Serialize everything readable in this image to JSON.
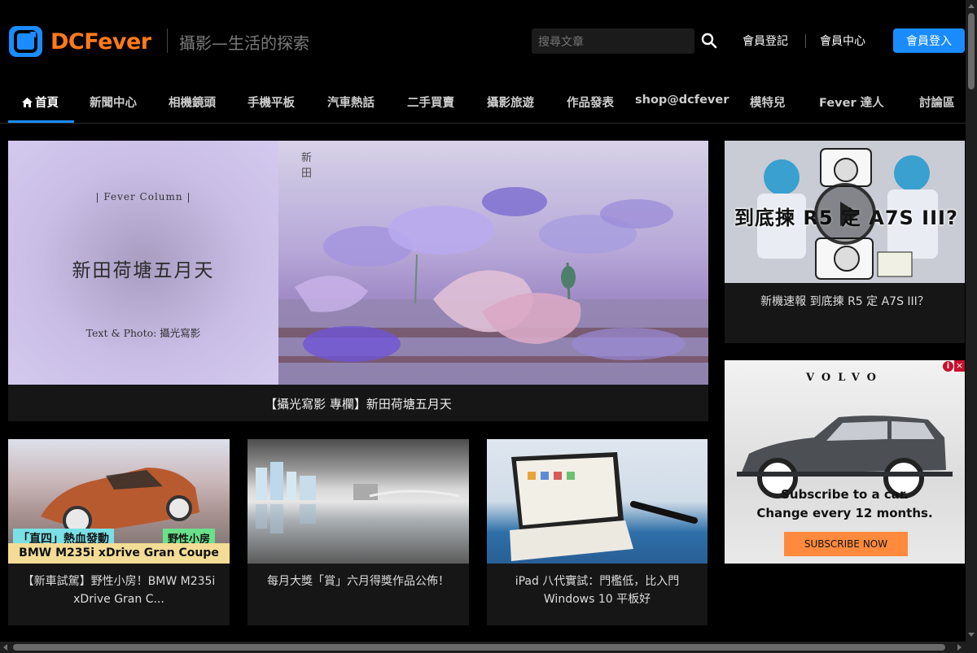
{
  "header": {
    "logo_text": "DCFever",
    "tagline": "攝影—生活的探索",
    "search_placeholder": "搜尋文章",
    "register": "會員登記",
    "member_center": "會員中心",
    "login": "會員登入"
  },
  "nav": {
    "items": [
      "首頁",
      "新聞中心",
      "相機鏡頭",
      "手機平板",
      "汽車熱話",
      "二手買賣",
      "攝影旅遊",
      "作品發表",
      "shop@dcfever",
      "模特兒",
      "Fever 達人",
      "討論區"
    ]
  },
  "hero": {
    "column_label": "| Fever Column |",
    "article_title": "新田荷塘五月天",
    "credit": "Text & Photo: 攝光寫影",
    "caption": "【攝光寫影 專欄】新田荷塘五月天"
  },
  "side_video": {
    "overlay": "到底揀 R5 定 A7S III?",
    "caption": "新機速報 到底揀 R5 定 A7S III？"
  },
  "ad": {
    "brand": "VOLVO",
    "line1": "Subscribe to a car.",
    "line2": "Change every 12 months.",
    "button": "SUBSCRIBE NOW"
  },
  "cards": [
    {
      "caption": "【新車試駕】野性小房！BMW M235i xDrive Gran C...",
      "badge1": "「直四」熱血發動",
      "badge2": "野性小房",
      "strip": "BMW M235i xDrive Gran Coupe"
    },
    {
      "caption": "每月大獎「賞」六月得獎作品公佈！"
    },
    {
      "caption": "iPad 八代實試：門檻低，比入門 Windows 10 平板好"
    }
  ]
}
